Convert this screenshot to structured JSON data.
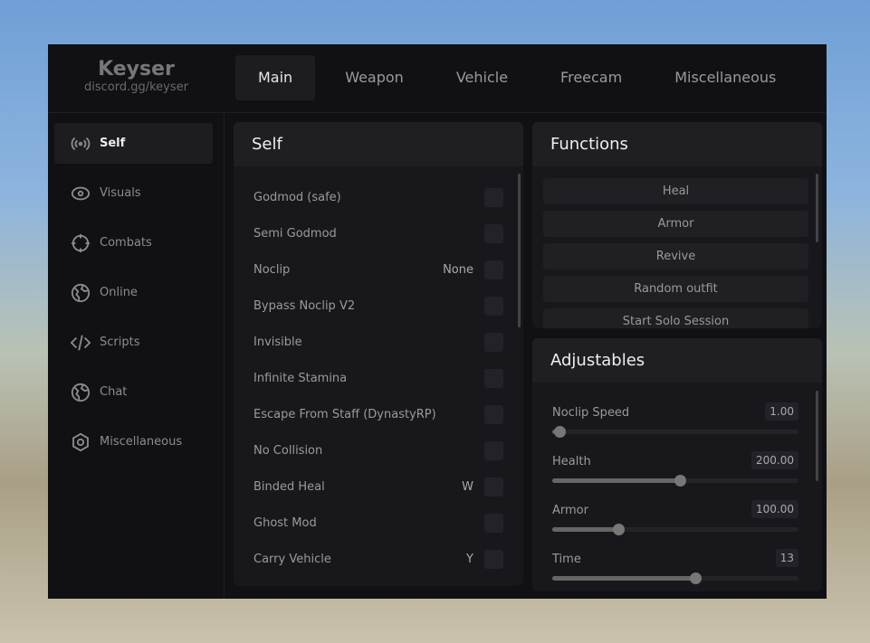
{
  "brand": {
    "title": "Keyser",
    "subtitle": "discord.gg/keyser"
  },
  "tabs": [
    "Main",
    "Weapon",
    "Vehicle",
    "Freecam",
    "Miscellaneous"
  ],
  "sidebar": [
    {
      "label": "Self",
      "icon": "broadcast-icon"
    },
    {
      "label": "Visuals",
      "icon": "eye-icon"
    },
    {
      "label": "Combats",
      "icon": "crosshair-icon"
    },
    {
      "label": "Online",
      "icon": "globe-icon"
    },
    {
      "label": "Scripts",
      "icon": "code-icon"
    },
    {
      "label": "Chat",
      "icon": "globe-icon"
    },
    {
      "label": "Miscellaneous",
      "icon": "gear-icon"
    }
  ],
  "self": {
    "title": "Self",
    "options": [
      {
        "label": "Godmod (safe)",
        "key": ""
      },
      {
        "label": "Semi Godmod",
        "key": ""
      },
      {
        "label": "Noclip",
        "key": "None"
      },
      {
        "label": "Bypass Noclip V2",
        "key": ""
      },
      {
        "label": "Invisible",
        "key": ""
      },
      {
        "label": "Infinite Stamina",
        "key": ""
      },
      {
        "label": "Escape From Staff (DynastyRP)",
        "key": ""
      },
      {
        "label": "No Collision",
        "key": ""
      },
      {
        "label": "Binded Heal",
        "key": "W"
      },
      {
        "label": "Ghost Mod",
        "key": ""
      },
      {
        "label": "Carry Vehicle",
        "key": "Y"
      }
    ]
  },
  "functions": {
    "title": "Functions",
    "buttons": [
      "Heal",
      "Armor",
      "Revive",
      "Random outfit",
      "Start Solo Session"
    ]
  },
  "adjustables": {
    "title": "Adjustables",
    "sliders": [
      {
        "label": "Noclip Speed",
        "value": "1.00",
        "fraction": 0.03
      },
      {
        "label": "Health",
        "value": "200.00",
        "fraction": 0.52
      },
      {
        "label": "Armor",
        "value": "100.00",
        "fraction": 0.27
      },
      {
        "label": "Time",
        "value": "13",
        "fraction": 0.58
      }
    ]
  },
  "colors": {
    "panel": "#111115",
    "accent": "#777777"
  }
}
